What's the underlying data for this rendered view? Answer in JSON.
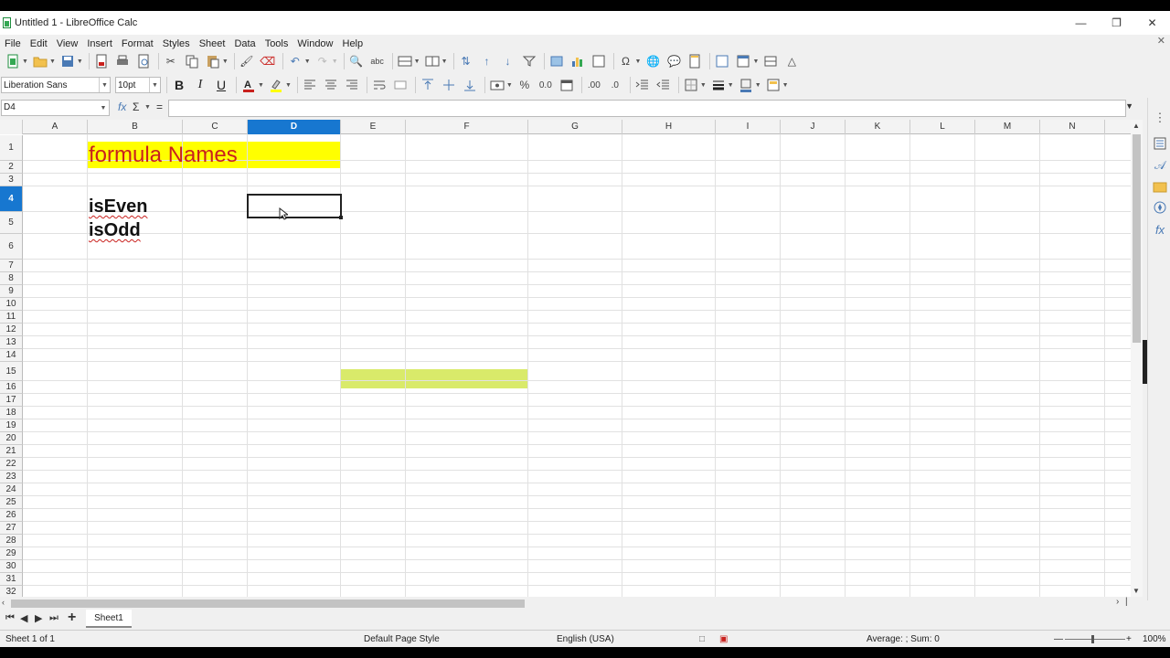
{
  "window": {
    "title": "Untitled 1 - LibreOffice Calc",
    "minimize_icon": "minimize-icon",
    "restore_icon": "restore-icon",
    "close_icon": "close-icon"
  },
  "menu": [
    "File",
    "Edit",
    "View",
    "Insert",
    "Format",
    "Styles",
    "Sheet",
    "Data",
    "Tools",
    "Window",
    "Help"
  ],
  "toolbar2": {
    "font_name": "Liberation Sans",
    "font_size": "10pt",
    "bold": "B",
    "italic": "I",
    "underline": "U"
  },
  "formula_bar": {
    "cell_ref": "D4",
    "fx": "fx",
    "sigma": "Σ",
    "equals": "=",
    "content": ""
  },
  "columns": [
    "A",
    "B",
    "C",
    "D",
    "E",
    "F",
    "G",
    "H",
    "I",
    "J",
    "K",
    "L",
    "M",
    "N"
  ],
  "selected_column": "D",
  "rows": [
    "1",
    "2",
    "3",
    "4",
    "5",
    "6",
    "7",
    "8",
    "9",
    "10",
    "11",
    "12",
    "13",
    "14",
    "15",
    "16",
    "17",
    "18",
    "19",
    "20",
    "21",
    "22",
    "23",
    "24",
    "25",
    "26",
    "27",
    "28",
    "29",
    "30",
    "31",
    "32"
  ],
  "selected_row": "4",
  "cells": {
    "b1": "formula Names",
    "b4": "isEven",
    "b5": "isOdd"
  },
  "colors": {
    "yellow_fill": "#ffff00",
    "green_fill": "#d9ea6a",
    "title_text": "#c9211e",
    "selection_blue": "#1777d0"
  },
  "sheet_tabs": [
    "Sheet1"
  ],
  "status": {
    "sheet": "Sheet 1 of 1",
    "page_style": "Default Page Style",
    "language": "English (USA)",
    "summary": "Average: ; Sum: 0",
    "zoom": "100%"
  }
}
